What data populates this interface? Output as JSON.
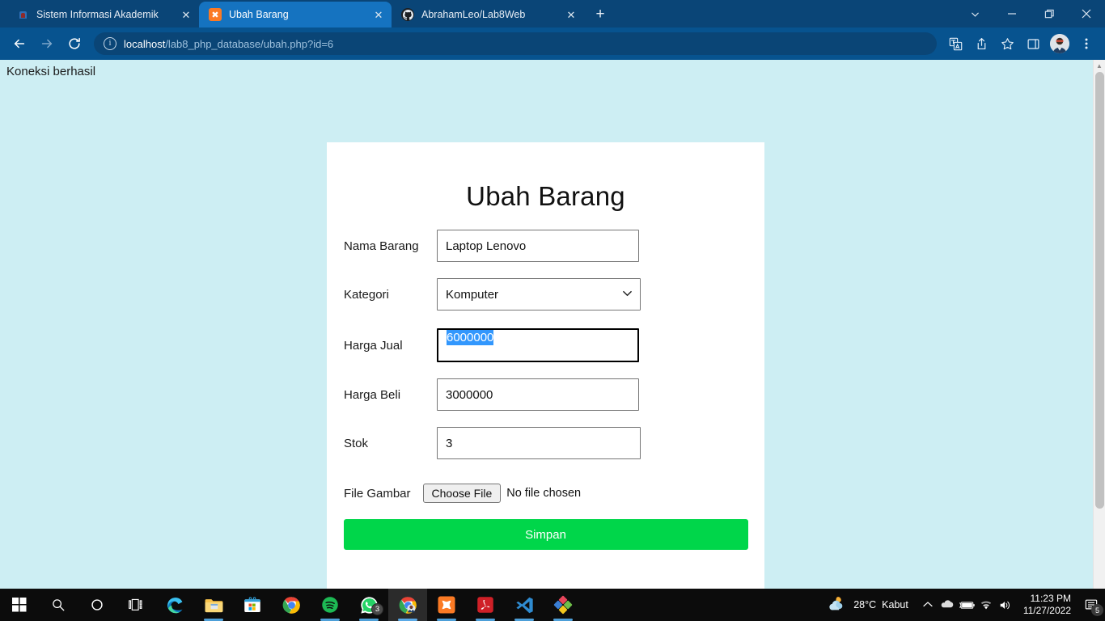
{
  "browser": {
    "tabs": [
      {
        "title": "Sistem Informasi Akademik",
        "favicon": "akademik-icon",
        "active": false,
        "close_label": "✕"
      },
      {
        "title": "Ubah Barang",
        "favicon": "xampp-icon",
        "active": true,
        "close_label": "✕"
      },
      {
        "title": "AbrahamLeo/Lab8Web",
        "favicon": "github-icon",
        "active": false,
        "close_label": "✕"
      }
    ],
    "new_tab_label": "+",
    "window_controls": {
      "tab_search": "⌄",
      "minimize": "—",
      "maximize": "❐",
      "close": "✕"
    },
    "toolbar": {
      "back": "←",
      "forward": "→",
      "reload": "⟳",
      "site_info": "i",
      "url_host": "localhost",
      "url_path": "/lab8_php_database/ubah.php?id=6",
      "translate": "translate-icon",
      "share": "share-icon",
      "bookmark": "★",
      "sidepanel": "▢",
      "menu": "⋮"
    }
  },
  "page": {
    "connection_message": "Koneksi berhasil",
    "card": {
      "title": "Ubah Barang",
      "fields": [
        {
          "label": "Nama Barang",
          "value": "Laptop Lenovo",
          "type": "text"
        },
        {
          "label": "Kategori",
          "value": "Komputer",
          "type": "select"
        },
        {
          "label": "Harga Jual",
          "value": "6000000",
          "type": "text",
          "focused": true,
          "selected": true
        },
        {
          "label": "Harga Beli",
          "value": "3000000",
          "type": "text"
        },
        {
          "label": "Stok",
          "value": "3",
          "type": "text"
        }
      ],
      "file_field": {
        "label": "File Gambar",
        "button_label": "Choose File",
        "status": "No file chosen"
      },
      "submit_label": "Simpan",
      "submit_color": "#00d64a"
    }
  },
  "scrollbar": {
    "up": "▲",
    "down": "▼"
  },
  "taskbar": {
    "items": [
      {
        "name": "start-button",
        "label": "Start"
      },
      {
        "name": "search-button",
        "label": "Search"
      },
      {
        "name": "cortana-button",
        "label": "Cortana"
      },
      {
        "name": "task-view-button",
        "label": "Task View"
      },
      {
        "name": "edge-icon",
        "label": "Microsoft Edge"
      },
      {
        "name": "file-explorer-icon",
        "label": "File Explorer"
      },
      {
        "name": "microsoft-store-icon",
        "label": "Microsoft Store"
      },
      {
        "name": "chrome-pinned-icon",
        "label": "Google Chrome"
      },
      {
        "name": "spotify-icon",
        "label": "Spotify"
      },
      {
        "name": "whatsapp-icon",
        "label": "WhatsApp",
        "badge": "3"
      },
      {
        "name": "chrome-active-icon",
        "label": "Google Chrome"
      },
      {
        "name": "xampp-icon",
        "label": "XAMPP"
      },
      {
        "name": "acrobat-icon",
        "label": "Adobe Acrobat"
      },
      {
        "name": "vscode-icon",
        "label": "Visual Studio Code"
      },
      {
        "name": "photos-icon",
        "label": "App"
      }
    ],
    "weather": {
      "temperature": "28°C",
      "condition": "Kabut"
    },
    "tray": {
      "show_hidden": "⌃",
      "onedrive": "onedrive-icon",
      "battery": "battery-icon",
      "network": "wifi-icon",
      "volume": "volume-icon"
    },
    "clock": {
      "time": "11:23 PM",
      "date": "11/27/2022"
    },
    "notifications": {
      "count": "5"
    }
  }
}
